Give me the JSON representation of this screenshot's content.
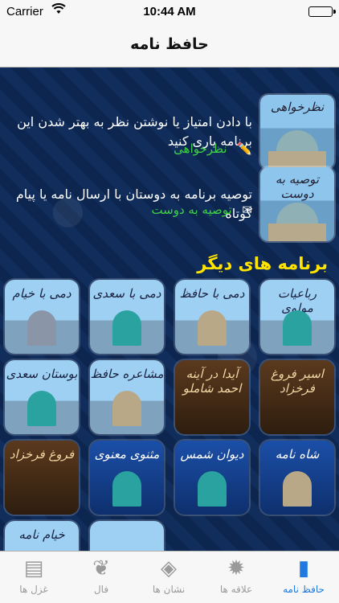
{
  "status": {
    "carrier": "Carrier",
    "time": "10:44 AM"
  },
  "nav": {
    "title": "حافظ نامه"
  },
  "promos": [
    {
      "thumb_caption": "نظرخواهی",
      "text": "با دادن امتیاز یا نوشتن نظر به بهتر شدن این برنامه یاری کنید",
      "link": "نظرخواهی"
    },
    {
      "thumb_caption": "توصیه به دوست",
      "text": "توصیه برنامه به دوستان با ارسال نامه یا پیام کوتاه",
      "link": "توصیه به دوست"
    }
  ],
  "section_title": "برنامه های دیگر",
  "apps": [
    {
      "name": "دمی با خیام",
      "style": "sky"
    },
    {
      "name": "دمی با سعدی",
      "style": "sky"
    },
    {
      "name": "دمی با حافظ",
      "style": "sky"
    },
    {
      "name": "رباعیات مولوی",
      "style": "sky"
    },
    {
      "name": "بوستان سعدی",
      "style": "sky"
    },
    {
      "name": "مشاعره حافظ",
      "style": "sky"
    },
    {
      "name": "آیدا در آینه احمد شاملو",
      "style": "dark"
    },
    {
      "name": "اسیر فروغ فرخزاد",
      "style": "dark"
    },
    {
      "name": "فروغ فرخزاد",
      "style": "dark"
    },
    {
      "name": "مثنوی معنوی",
      "style": "blue"
    },
    {
      "name": "دیوان شمس",
      "style": "blue"
    },
    {
      "name": "شاه نامه",
      "style": "blue"
    },
    {
      "name": "خیام نامه",
      "style": "sky"
    },
    {
      "name": "",
      "style": "sky"
    }
  ],
  "tabs": [
    {
      "label": "غزل ها",
      "icon": "book-grid-icon",
      "glyph": "▤"
    },
    {
      "label": "فال",
      "icon": "bird-icon",
      "glyph": "❦"
    },
    {
      "label": "نشان ها",
      "icon": "tag-icon",
      "glyph": "◈"
    },
    {
      "label": "علاقه ها",
      "icon": "sun-icon",
      "glyph": "✹"
    },
    {
      "label": "حافظ نامه",
      "icon": "book-icon",
      "glyph": "▮"
    }
  ],
  "colors": {
    "accent": "#1f7ae0",
    "section": "#ffe400",
    "link": "#3fcf47"
  }
}
